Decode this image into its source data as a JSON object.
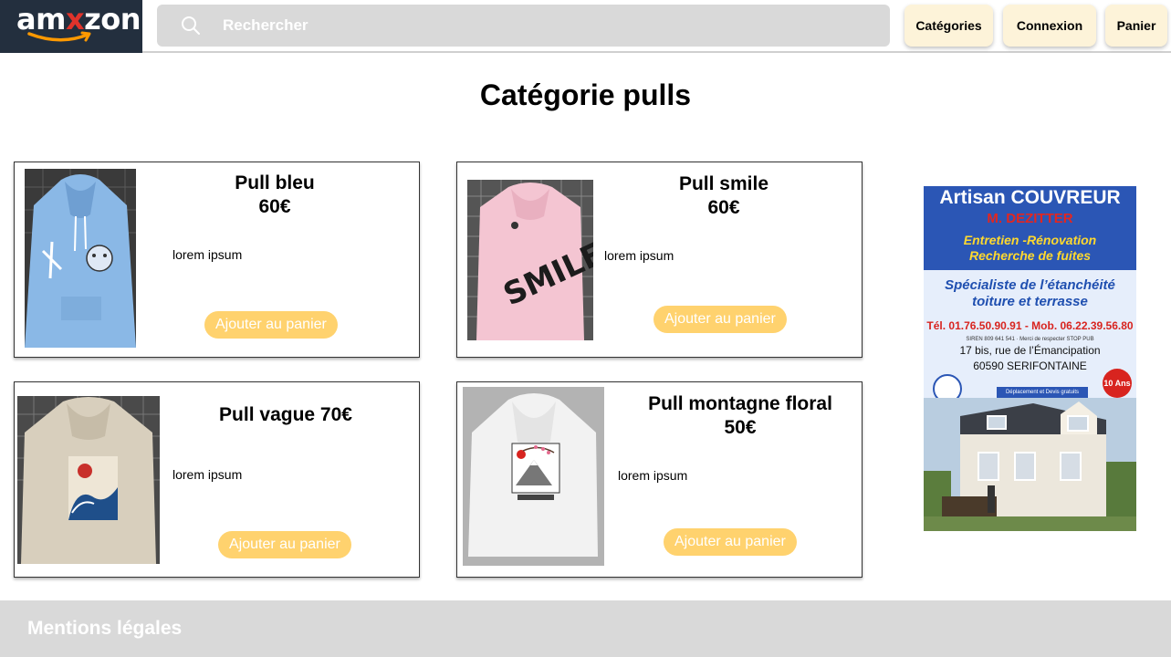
{
  "header": {
    "logo": {
      "text_a": "am",
      "text_x": "x",
      "text_b": "zon"
    },
    "search": {
      "placeholder": "Rechercher"
    },
    "nav": {
      "categories": "Catégories",
      "login": "Connexion",
      "cart": "Panier"
    }
  },
  "page": {
    "title": "Catégorie pulls"
  },
  "products": [
    {
      "name": "Pull bleu",
      "price": "60€",
      "description": "lorem ipsum",
      "button": "Ajouter au panier",
      "color": "#8ab8e6"
    },
    {
      "name": "Pull smile",
      "price": "60€",
      "description": "lorem ipsum",
      "button": "Ajouter au panier",
      "color": "#f4c5d2"
    },
    {
      "name": "Pull vague 70€",
      "price": "",
      "description": "lorem ipsum",
      "button": "Ajouter au panier",
      "color": "#d8cfbd"
    },
    {
      "name": "Pull montagne floral",
      "price": "50€",
      "description": "lorem ipsum",
      "button": "Ajouter au panier",
      "color": "#f2f2f2"
    }
  ],
  "ad": {
    "title": "Artisan COUVREUR",
    "name": "M. DEZITTER",
    "service_1": "Entretien -Rénovation",
    "service_2": "Recherche de fuites",
    "spec_1": "Spécialiste de l’étanchéité",
    "spec_2": "toiture et terrasse",
    "tel": "Tél. 01.76.50.90.91 - Mob. 06.22.39.56.80",
    "siren": "SIREN 809 641 541 · Merci de respecter STOP PUB",
    "address_1": "17 bis, rue de l’Émancipation",
    "address_2": "60590 SERIFONTAINE",
    "devis": "Déplacement et Devis gratuits",
    "badge": "10 Ans"
  },
  "footer": {
    "legal": "Mentions légales"
  },
  "colors": {
    "accent_button": "#ffd26e",
    "nav_button": "#fdf3d9",
    "logo_bg": "#232f3e",
    "search_bg": "#d9d9d9"
  }
}
